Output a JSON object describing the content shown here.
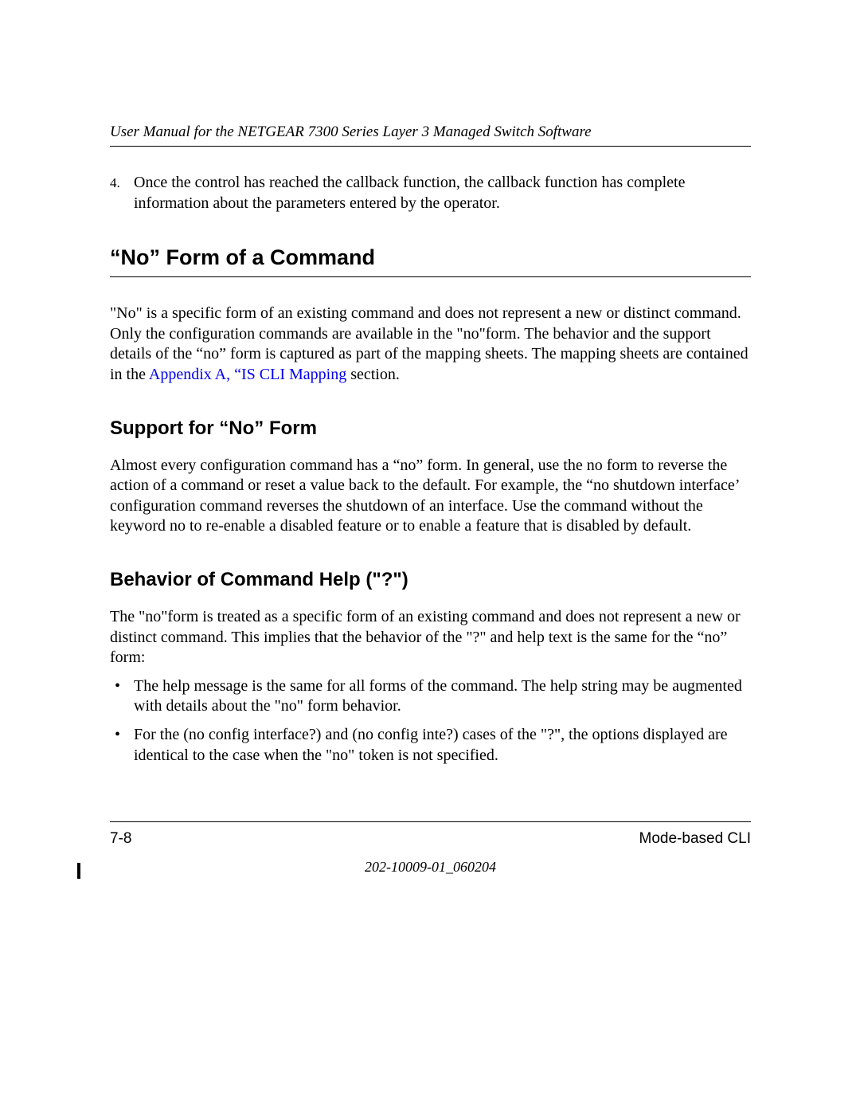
{
  "header": {
    "title": "User Manual for the NETGEAR 7300 Series Layer 3 Managed Switch Software"
  },
  "ordered": {
    "number": "4.",
    "text": "Once the control has reached the callback function, the callback function has complete information about the parameters entered by the operator."
  },
  "section1": {
    "heading": "“No” Form of a Command",
    "para_before": "\"No\" is a specific form of an existing command and does not represent a new or distinct command. Only the configuration commands are available in the \"no\"form. The behavior and the support details of the “no” form is captured as part of the mapping sheets. The mapping sheets are contained in the ",
    "link": "Appendix A, “IS CLI Mapping",
    "para_after": " section."
  },
  "section2": {
    "heading": "Support for “No” Form",
    "para": "Almost every configuration command has a “no” form. In general, use the no form to reverse the action of a command or reset a value back to the default. For example, the “no shutdown interface’ configuration command reverses the shutdown of an interface. Use the command without the keyword no to re-enable a disabled feature or to enable a feature that is disabled by default."
  },
  "section3": {
    "heading": "Behavior of Command Help (\"?\")",
    "para": "The \"no\"form is treated as a specific form of an existing command and does not represent a new or distinct command. This implies that the behavior of the \"?\" and help text is the same for the “no” form:",
    "bullets": [
      "The help message is the same for all forms of the command. The help string may be augmented with details about the \"no\" form behavior.",
      "For the (no config interface?) and (no config inte?) cases of the \"?\", the options displayed are identical to the case when the \"no\" token is not specified."
    ]
  },
  "footer": {
    "page": "7-8",
    "section": "Mode-based CLI",
    "docnum": "202-10009-01_060204"
  }
}
